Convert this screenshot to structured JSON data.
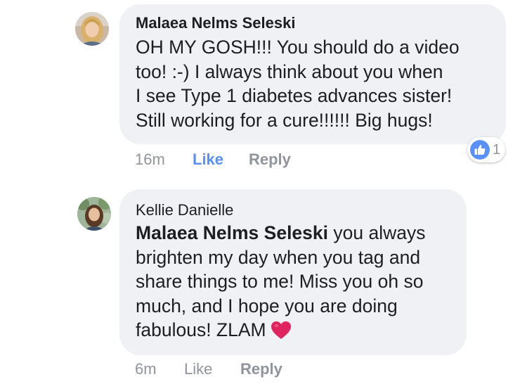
{
  "comments": [
    {
      "author": "Malaea Nelms Seleski",
      "text_lines": [
        "OH MY GOSH!!!  You should do a video",
        "too!  :-)  I always think about you when",
        "I see Type 1 diabetes advances sister!",
        "Still working for a cure!!!!!!  Big hugs!"
      ],
      "time": "16m",
      "like_label": "Like",
      "like_active": true,
      "reply_label": "Reply",
      "reaction": {
        "icon": "thumbs-up-icon",
        "count": "1",
        "color": "#5890ff"
      },
      "avatar": "avatar-blonde-woman"
    },
    {
      "author": "Kellie Danielle",
      "mention": "Malaea Nelms Seleski",
      "text_lines": [
        " you always",
        "brighten my day when you tag and",
        "share things to me! Miss you oh so",
        "much, and I hope you are doing",
        "fabulous! ZLAM"
      ],
      "emoji": "red-heart-icon",
      "time": "6m",
      "like_label": "Like",
      "like_active": false,
      "reply_label": "Reply",
      "avatar": "avatar-woman-outdoors"
    }
  ],
  "colors": {
    "bubble": "#f0f1f5",
    "text": "#1c1e21",
    "meta": "#90949c",
    "like_active": "#5890ff",
    "heart": "#e0245e"
  }
}
